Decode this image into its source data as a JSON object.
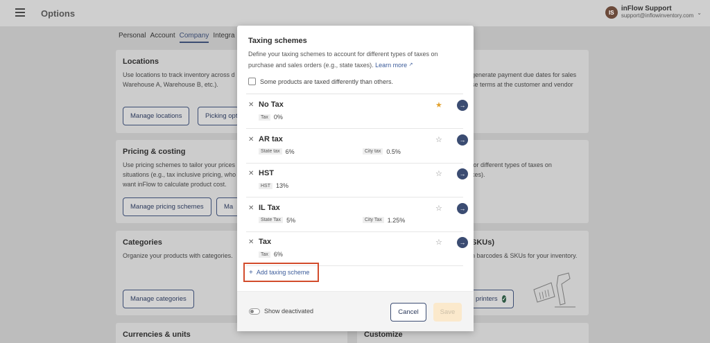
{
  "app": {
    "title": "Options"
  },
  "user": {
    "initials": "IS",
    "name": "inFlow Support",
    "email": "support@inflowinventory.com"
  },
  "settings_tabs": [
    "Personal",
    "Account",
    "Company",
    "Integra"
  ],
  "cards": {
    "locations": {
      "title": "Locations",
      "desc_line1": "Use locations to track inventory across d",
      "desc_line2": "Warehouse A, Warehouse B, etc.).",
      "btn1": "Manage locations",
      "btn2": "Picking opt"
    },
    "payment_terms": {
      "line1": "generate payment due dates for sales",
      "line2": "se terms at the customer and vendor"
    },
    "pricing": {
      "title": "Pricing & costing",
      "line1": "Use pricing schemes to tailor your prices",
      "line2": "situations (e.g., tax inclusive pricing, who",
      "line3": "want inFlow to calculate product cost.",
      "btn1": "Manage pricing schemes",
      "btn2": "Ma"
    },
    "taxing": {
      "line1": "for different types of taxes on",
      "line2": "xes)."
    },
    "categories": {
      "title": "Categories",
      "desc": "Organize your products with categories.",
      "btn": "Manage categories"
    },
    "barcodes": {
      "title": "SKUs)",
      "desc": "n barcodes & SKUs for your inventory.",
      "btn": "printers"
    },
    "currencies": {
      "title": "Currencies & units"
    },
    "customize": {
      "title": "Customize"
    }
  },
  "modal": {
    "title": "Taxing schemes",
    "desc": "Define your taxing schemes to account for different types of taxes on purchase and sales orders (e.g., state taxes).",
    "learn_more": "Learn more",
    "checkbox_label": "Some products are taxed differently than others.",
    "add_label": "Add taxing scheme",
    "show_deactivated": "Show deactivated",
    "cancel": "Cancel",
    "save": "Save",
    "schemes": [
      {
        "name": "No Tax",
        "favorite": true,
        "taxes": [
          {
            "label": "Tax",
            "rate": "0%"
          }
        ]
      },
      {
        "name": "AR tax",
        "favorite": false,
        "taxes": [
          {
            "label": "State tax",
            "rate": "6%"
          },
          {
            "label": "City tax",
            "rate": "0.5%"
          }
        ]
      },
      {
        "name": "HST",
        "favorite": false,
        "taxes": [
          {
            "label": "HST",
            "rate": "13%"
          }
        ]
      },
      {
        "name": "IL Tax",
        "favorite": false,
        "taxes": [
          {
            "label": "State Tax",
            "rate": "5%"
          },
          {
            "label": "City Tax",
            "rate": "1.25%"
          }
        ]
      },
      {
        "name": "Tax",
        "favorite": false,
        "taxes": [
          {
            "label": "Tax",
            "rate": "6%"
          }
        ]
      }
    ]
  },
  "colors": {
    "primary": "#3b4c72",
    "favorite_star": "#e2a12d",
    "highlight_border": "#d24b2b",
    "save_disabled_bg": "#fbe9cc"
  },
  "icons": {
    "close": "close-icon",
    "star": "star-icon",
    "arrow": "arrow-right-icon",
    "menu": "hamburger-icon",
    "external": "external-link-icon",
    "chevron": "chevron-down-icon",
    "plus": "plus-icon"
  }
}
